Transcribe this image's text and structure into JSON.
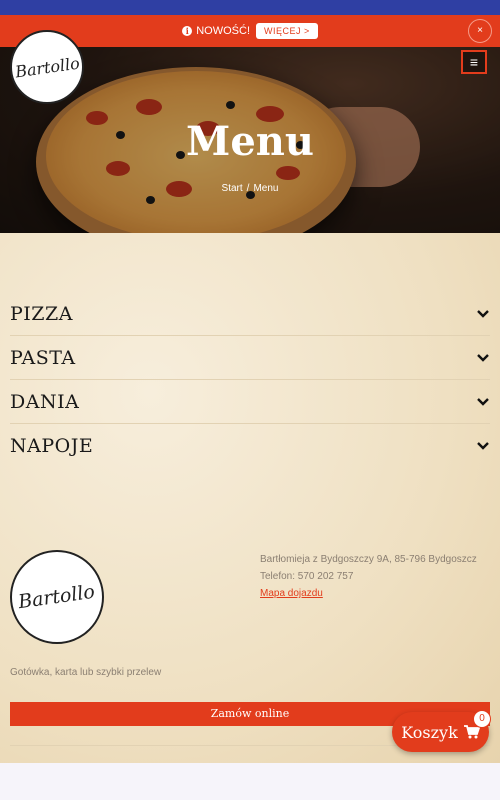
{
  "promo": {
    "label": "NOWOŚĆ!",
    "more_label": "WIĘCEJ >",
    "close_label": "×",
    "info_icon": "info-icon"
  },
  "brand": {
    "name": "Bartollo",
    "accent": "#e23c1c",
    "topbar": "#2f3fa3"
  },
  "nav": {
    "menu_icon": "hamburger-icon",
    "menu_glyph": "≡"
  },
  "hero": {
    "title": "Menu",
    "breadcrumb": {
      "home": "Start",
      "separator": "/",
      "current": "Menu"
    }
  },
  "categories": [
    {
      "label": "PIZZA"
    },
    {
      "label": "PASTA"
    },
    {
      "label": "DANIA"
    },
    {
      "label": "NAPOJE"
    }
  ],
  "footer": {
    "address": "Bartłomieja z Bydgoszczy 9A, 85-796 Bydgoszcz",
    "phone": "Telefon: 570 202 757",
    "map_link": "Mapa dojazdu",
    "payment": "Gotówka, karta lub szybki przelew",
    "order_button": "Zamów online"
  },
  "cart": {
    "label": "Koszyk",
    "count": "0",
    "icon": "shopping-cart-icon"
  }
}
